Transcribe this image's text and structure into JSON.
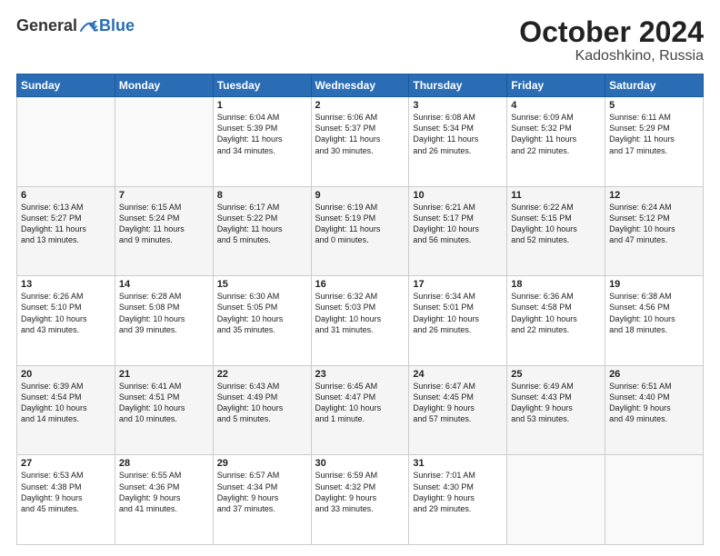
{
  "header": {
    "logo": {
      "general": "General",
      "blue": "Blue"
    },
    "title": "October 2024",
    "location": "Kadoshkino, Russia"
  },
  "days_of_week": [
    "Sunday",
    "Monday",
    "Tuesday",
    "Wednesday",
    "Thursday",
    "Friday",
    "Saturday"
  ],
  "weeks": [
    [
      {
        "num": "",
        "info": ""
      },
      {
        "num": "",
        "info": ""
      },
      {
        "num": "1",
        "info": "Sunrise: 6:04 AM\nSunset: 5:39 PM\nDaylight: 11 hours\nand 34 minutes."
      },
      {
        "num": "2",
        "info": "Sunrise: 6:06 AM\nSunset: 5:37 PM\nDaylight: 11 hours\nand 30 minutes."
      },
      {
        "num": "3",
        "info": "Sunrise: 6:08 AM\nSunset: 5:34 PM\nDaylight: 11 hours\nand 26 minutes."
      },
      {
        "num": "4",
        "info": "Sunrise: 6:09 AM\nSunset: 5:32 PM\nDaylight: 11 hours\nand 22 minutes."
      },
      {
        "num": "5",
        "info": "Sunrise: 6:11 AM\nSunset: 5:29 PM\nDaylight: 11 hours\nand 17 minutes."
      }
    ],
    [
      {
        "num": "6",
        "info": "Sunrise: 6:13 AM\nSunset: 5:27 PM\nDaylight: 11 hours\nand 13 minutes."
      },
      {
        "num": "7",
        "info": "Sunrise: 6:15 AM\nSunset: 5:24 PM\nDaylight: 11 hours\nand 9 minutes."
      },
      {
        "num": "8",
        "info": "Sunrise: 6:17 AM\nSunset: 5:22 PM\nDaylight: 11 hours\nand 5 minutes."
      },
      {
        "num": "9",
        "info": "Sunrise: 6:19 AM\nSunset: 5:19 PM\nDaylight: 11 hours\nand 0 minutes."
      },
      {
        "num": "10",
        "info": "Sunrise: 6:21 AM\nSunset: 5:17 PM\nDaylight: 10 hours\nand 56 minutes."
      },
      {
        "num": "11",
        "info": "Sunrise: 6:22 AM\nSunset: 5:15 PM\nDaylight: 10 hours\nand 52 minutes."
      },
      {
        "num": "12",
        "info": "Sunrise: 6:24 AM\nSunset: 5:12 PM\nDaylight: 10 hours\nand 47 minutes."
      }
    ],
    [
      {
        "num": "13",
        "info": "Sunrise: 6:26 AM\nSunset: 5:10 PM\nDaylight: 10 hours\nand 43 minutes."
      },
      {
        "num": "14",
        "info": "Sunrise: 6:28 AM\nSunset: 5:08 PM\nDaylight: 10 hours\nand 39 minutes."
      },
      {
        "num": "15",
        "info": "Sunrise: 6:30 AM\nSunset: 5:05 PM\nDaylight: 10 hours\nand 35 minutes."
      },
      {
        "num": "16",
        "info": "Sunrise: 6:32 AM\nSunset: 5:03 PM\nDaylight: 10 hours\nand 31 minutes."
      },
      {
        "num": "17",
        "info": "Sunrise: 6:34 AM\nSunset: 5:01 PM\nDaylight: 10 hours\nand 26 minutes."
      },
      {
        "num": "18",
        "info": "Sunrise: 6:36 AM\nSunset: 4:58 PM\nDaylight: 10 hours\nand 22 minutes."
      },
      {
        "num": "19",
        "info": "Sunrise: 6:38 AM\nSunset: 4:56 PM\nDaylight: 10 hours\nand 18 minutes."
      }
    ],
    [
      {
        "num": "20",
        "info": "Sunrise: 6:39 AM\nSunset: 4:54 PM\nDaylight: 10 hours\nand 14 minutes."
      },
      {
        "num": "21",
        "info": "Sunrise: 6:41 AM\nSunset: 4:51 PM\nDaylight: 10 hours\nand 10 minutes."
      },
      {
        "num": "22",
        "info": "Sunrise: 6:43 AM\nSunset: 4:49 PM\nDaylight: 10 hours\nand 5 minutes."
      },
      {
        "num": "23",
        "info": "Sunrise: 6:45 AM\nSunset: 4:47 PM\nDaylight: 10 hours\nand 1 minute."
      },
      {
        "num": "24",
        "info": "Sunrise: 6:47 AM\nSunset: 4:45 PM\nDaylight: 9 hours\nand 57 minutes."
      },
      {
        "num": "25",
        "info": "Sunrise: 6:49 AM\nSunset: 4:43 PM\nDaylight: 9 hours\nand 53 minutes."
      },
      {
        "num": "26",
        "info": "Sunrise: 6:51 AM\nSunset: 4:40 PM\nDaylight: 9 hours\nand 49 minutes."
      }
    ],
    [
      {
        "num": "27",
        "info": "Sunrise: 6:53 AM\nSunset: 4:38 PM\nDaylight: 9 hours\nand 45 minutes."
      },
      {
        "num": "28",
        "info": "Sunrise: 6:55 AM\nSunset: 4:36 PM\nDaylight: 9 hours\nand 41 minutes."
      },
      {
        "num": "29",
        "info": "Sunrise: 6:57 AM\nSunset: 4:34 PM\nDaylight: 9 hours\nand 37 minutes."
      },
      {
        "num": "30",
        "info": "Sunrise: 6:59 AM\nSunset: 4:32 PM\nDaylight: 9 hours\nand 33 minutes."
      },
      {
        "num": "31",
        "info": "Sunrise: 7:01 AM\nSunset: 4:30 PM\nDaylight: 9 hours\nand 29 minutes."
      },
      {
        "num": "",
        "info": ""
      },
      {
        "num": "",
        "info": ""
      }
    ]
  ]
}
